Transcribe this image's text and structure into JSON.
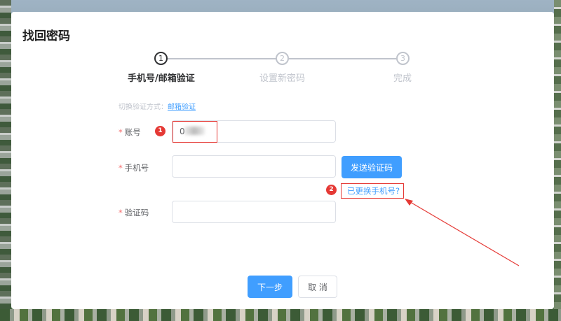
{
  "page": {
    "title": "找回密码"
  },
  "steps": [
    {
      "number": "1",
      "label": "手机号/邮箱验证",
      "status": "active"
    },
    {
      "number": "2",
      "label": "设置新密码",
      "status": "pending"
    },
    {
      "number": "3",
      "label": "完成",
      "status": "pending"
    }
  ],
  "switch": {
    "prefix": "切换验证方式：",
    "link": "邮箱验证"
  },
  "form": {
    "required_mark": "*",
    "account_label": "账号",
    "account_value": "0",
    "phone_label": "手机号",
    "phone_value": "",
    "code_label": "验证码",
    "code_value": ""
  },
  "buttons": {
    "send_code": "发送验证码",
    "changed_phone": "已更换手机号?",
    "next": "下一步",
    "cancel": "取 消"
  },
  "annotations": {
    "badge1": "1",
    "badge2": "2",
    "color": "#e53935"
  },
  "colors": {
    "primary": "#409eff",
    "required": "#f56c6c"
  }
}
